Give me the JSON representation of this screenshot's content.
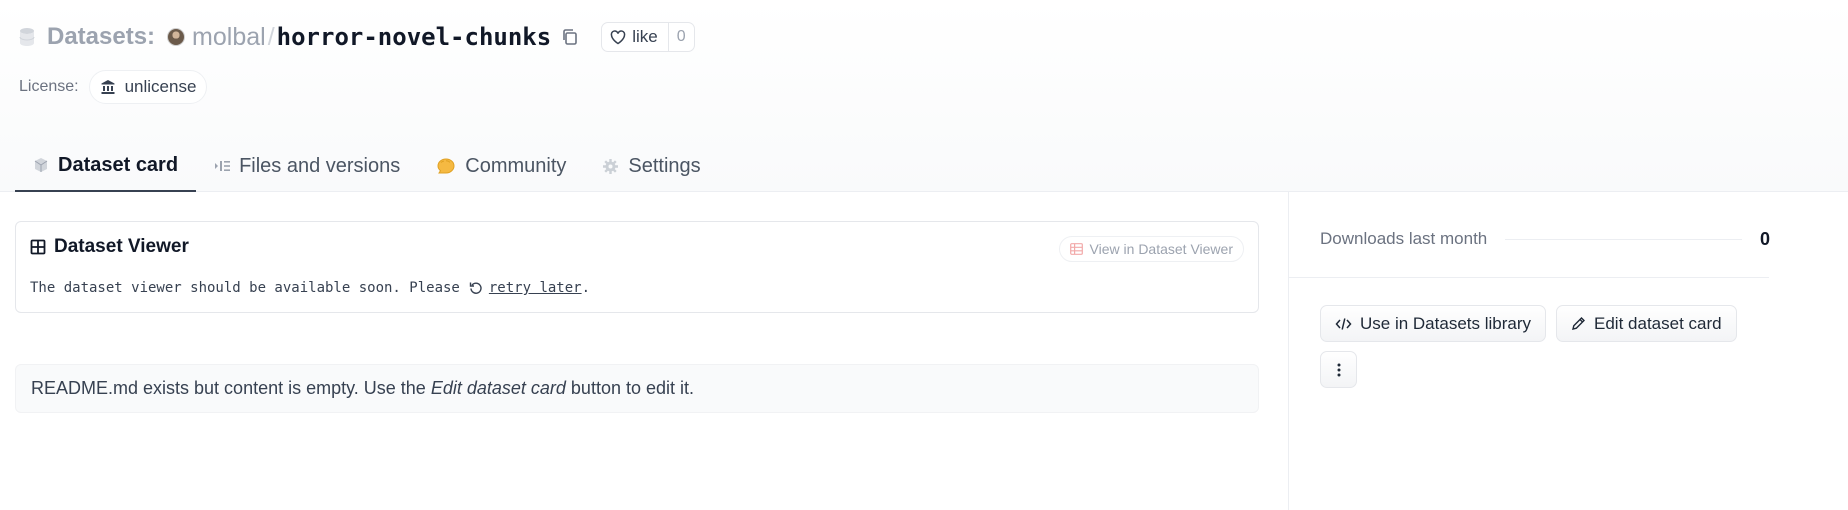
{
  "header": {
    "breadcrumb_root": "Datasets:",
    "user": "molbal",
    "separator": "/",
    "repo_name": "horror-novel-chunks",
    "like": {
      "label": "like",
      "count": "0"
    },
    "license_label": "License:",
    "license_value": "unlicense"
  },
  "tabs": [
    {
      "label": "Dataset card",
      "icon": "cube-icon",
      "active": true
    },
    {
      "label": "Files and versions",
      "icon": "files-icon",
      "active": false
    },
    {
      "label": "Community",
      "icon": "community-icon",
      "active": false
    },
    {
      "label": "Settings",
      "icon": "gear-icon",
      "active": false
    }
  ],
  "viewer": {
    "title": "Dataset Viewer",
    "open_link": "View in Dataset Viewer",
    "message_prefix": "The dataset viewer should be available soon. Please",
    "retry_link": "retry later",
    "message_suffix": "."
  },
  "readme": {
    "text_before": "README.md exists but content is empty. Use the ",
    "emphasis": "Edit dataset card",
    "text_after": " button to edit it."
  },
  "sidebar": {
    "downloads_label": "Downloads last month",
    "downloads_value": "0",
    "use_library_button": "Use in Datasets library",
    "edit_card_button": "Edit dataset card"
  },
  "colors": {
    "community_icon": "#f5b942",
    "text_primary": "#111827",
    "text_muted": "#9ca3af"
  }
}
